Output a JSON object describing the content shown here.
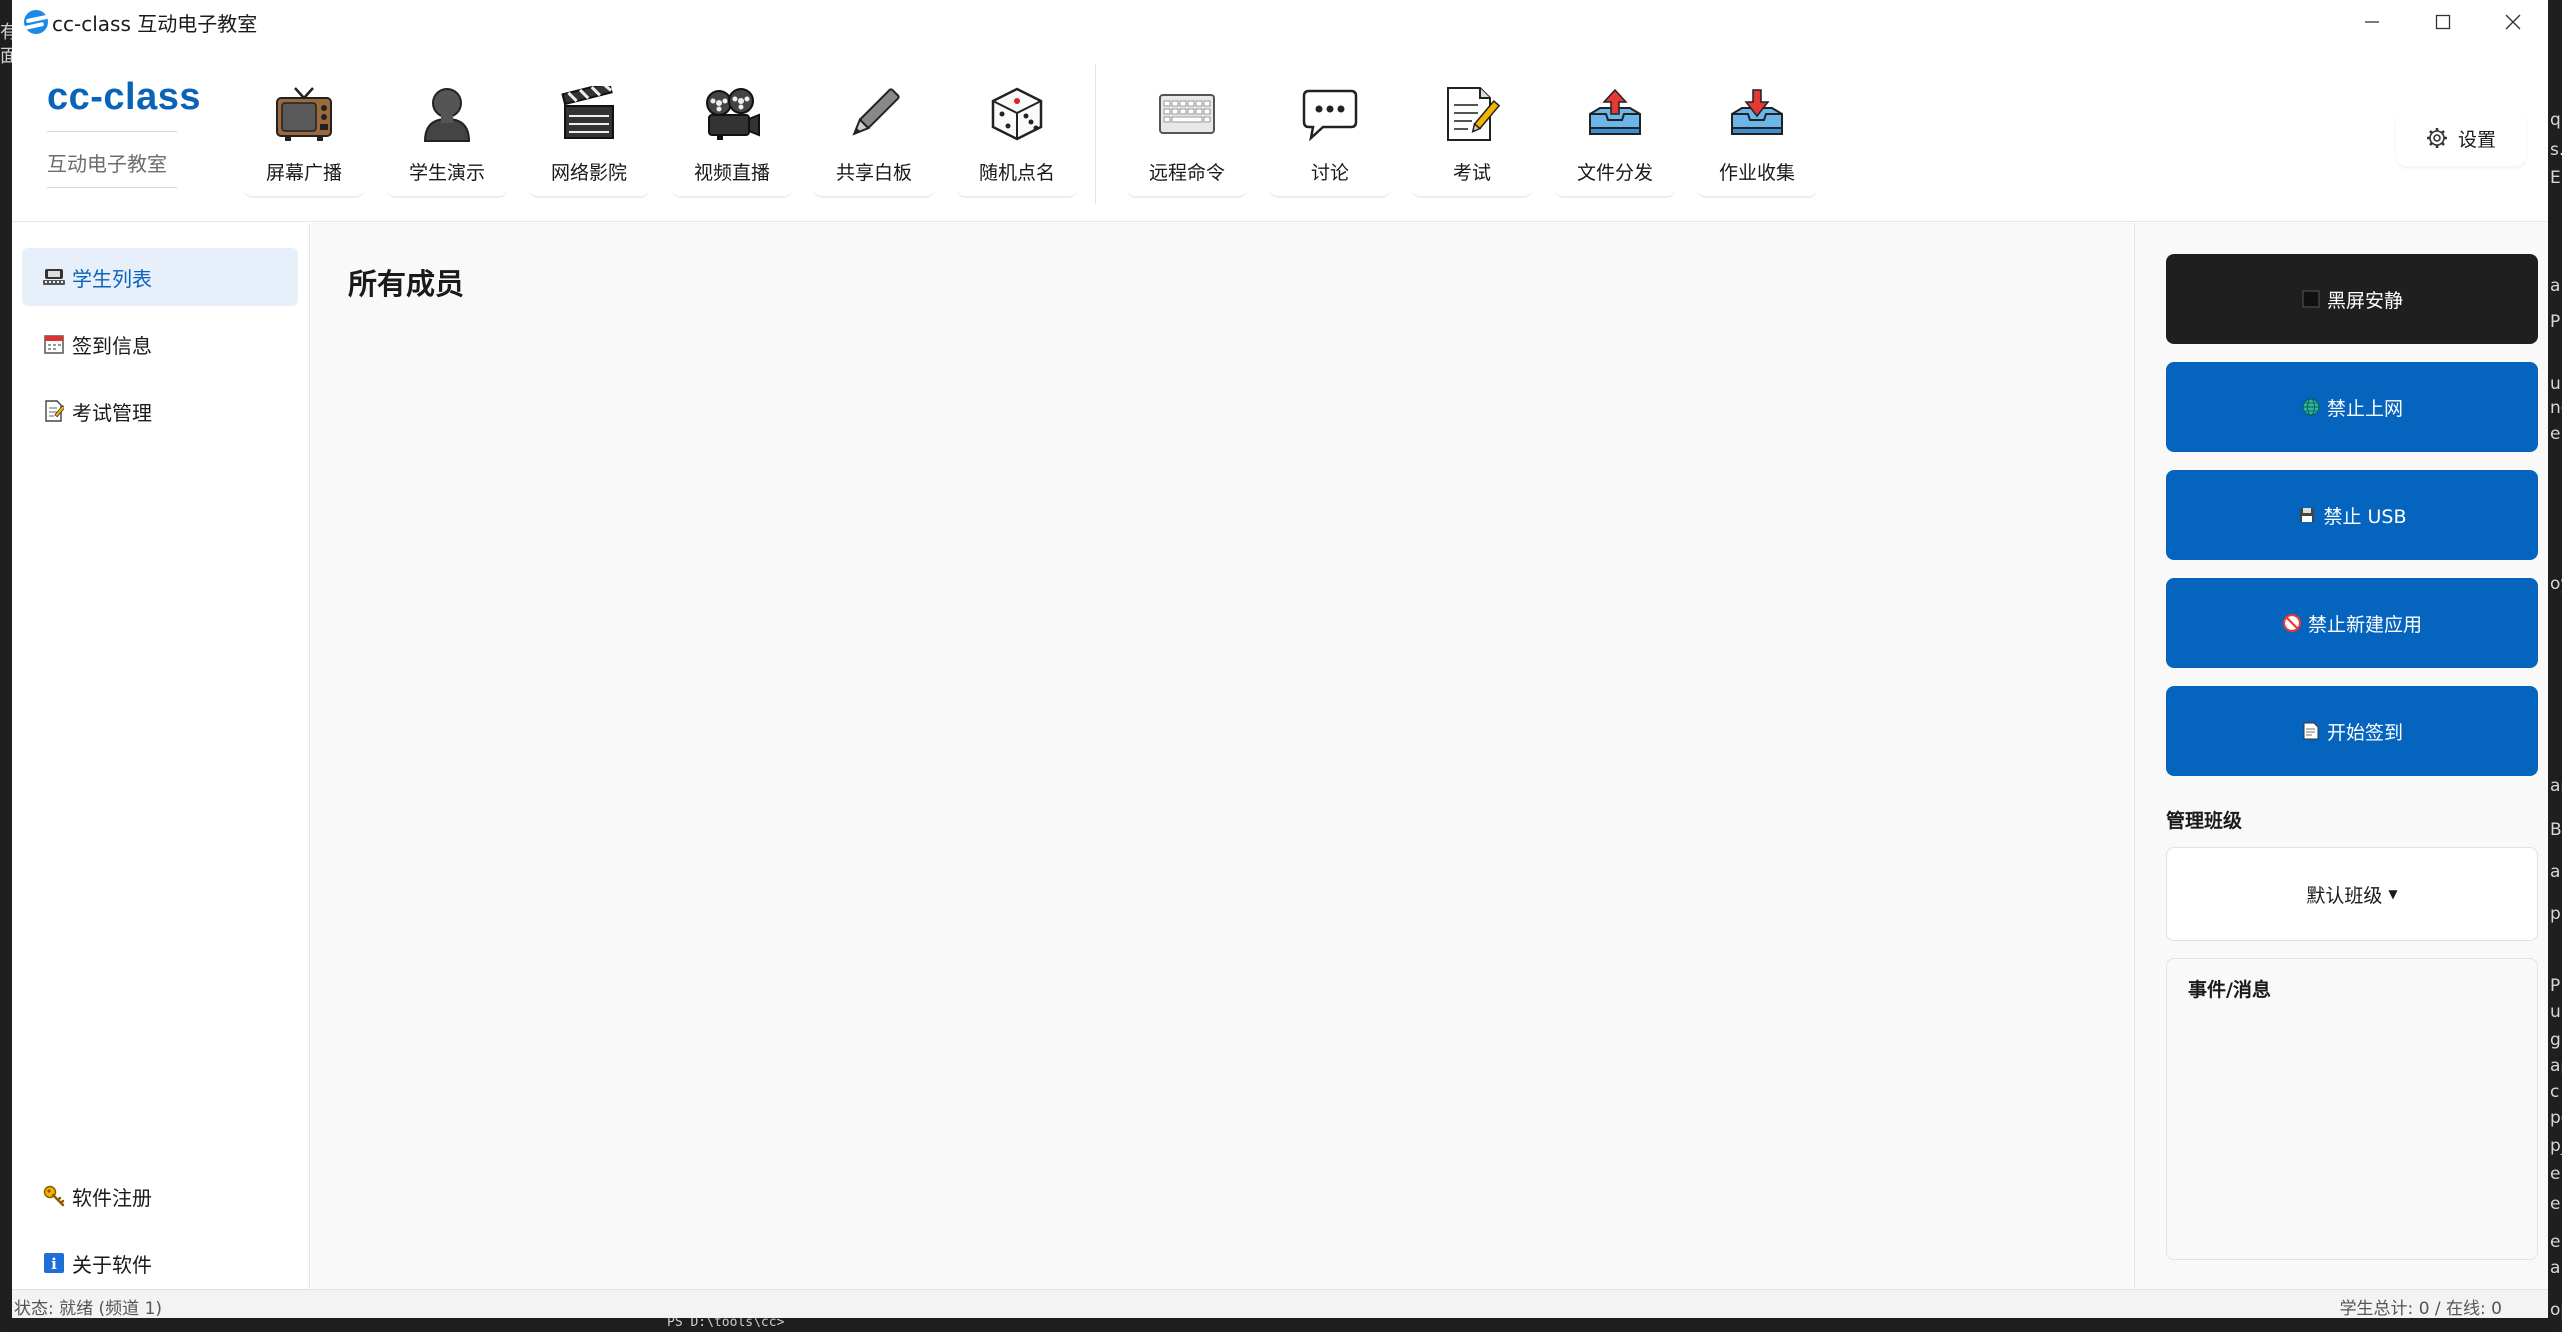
{
  "window": {
    "title": "cc-class 互动电子教室"
  },
  "brand": {
    "title": "cc-class",
    "subtitle": "互动电子教室"
  },
  "toolbar": {
    "tools": [
      {
        "label": "屏幕广播",
        "icon": "tv-icon"
      },
      {
        "label": "学生演示",
        "icon": "student-icon"
      },
      {
        "label": "网络影院",
        "icon": "clapperboard-icon"
      },
      {
        "label": "视频直播",
        "icon": "film-projector-icon"
      },
      {
        "label": "共享白板",
        "icon": "pen-icon"
      },
      {
        "label": "随机点名",
        "icon": "dice-icon"
      },
      {
        "label": "远程命令",
        "icon": "keyboard-icon"
      },
      {
        "label": "讨论",
        "icon": "speech-bubble-icon"
      },
      {
        "label": "考试",
        "icon": "memo-icon"
      },
      {
        "label": "文件分发",
        "icon": "upload-tray-icon"
      },
      {
        "label": "作业收集",
        "icon": "download-tray-icon"
      }
    ],
    "settings_label": "设置"
  },
  "sidebar": {
    "items": [
      {
        "label": "学生列表",
        "icon": "student-list-icon",
        "active": true
      },
      {
        "label": "签到信息",
        "icon": "calendar-icon",
        "active": false
      },
      {
        "label": "考试管理",
        "icon": "memo-icon",
        "active": false
      }
    ],
    "bottom_items": [
      {
        "label": "软件注册",
        "icon": "key-icon"
      },
      {
        "label": "关于软件",
        "icon": "info-icon"
      }
    ]
  },
  "main": {
    "title": "所有成员"
  },
  "right_panel": {
    "buttons": [
      {
        "label": "黑屏安静",
        "icon": "black-square-icon",
        "style": "dark"
      },
      {
        "label": "禁止上网",
        "icon": "globe-icon",
        "style": "blue"
      },
      {
        "label": "禁止 USB",
        "icon": "floppy-icon",
        "style": "blue"
      },
      {
        "label": "禁止新建应用",
        "icon": "no-entry-icon",
        "style": "blue"
      },
      {
        "label": "开始签到",
        "icon": "memo-icon",
        "style": "blue"
      }
    ],
    "class_label": "管理班级",
    "class_value": "默认班级",
    "events_title": "事件/消息"
  },
  "status": {
    "left": "状态: 就绪 (频道 1)",
    "right": "学生总计: 0 / 在线: 0"
  },
  "background": {
    "left_chars": [
      "有",
      "面"
    ],
    "right_chars": [
      "q",
      "s.",
      "E",
      "a",
      "P",
      "u",
      "no",
      "e",
      "oy",
      "ar",
      "B",
      "a",
      "p",
      "P",
      "ur",
      "g",
      "ap",
      "c",
      "po",
      "p_",
      "er",
      "en",
      "er",
      "a",
      "op"
    ],
    "terminal_prompt": "PS D:\\tools\\cc>"
  },
  "colors": {
    "accent": "#0a63b8",
    "button_blue": "#0564be",
    "button_dark": "#1f1f1f",
    "active_nav_bg": "#e6effa"
  }
}
